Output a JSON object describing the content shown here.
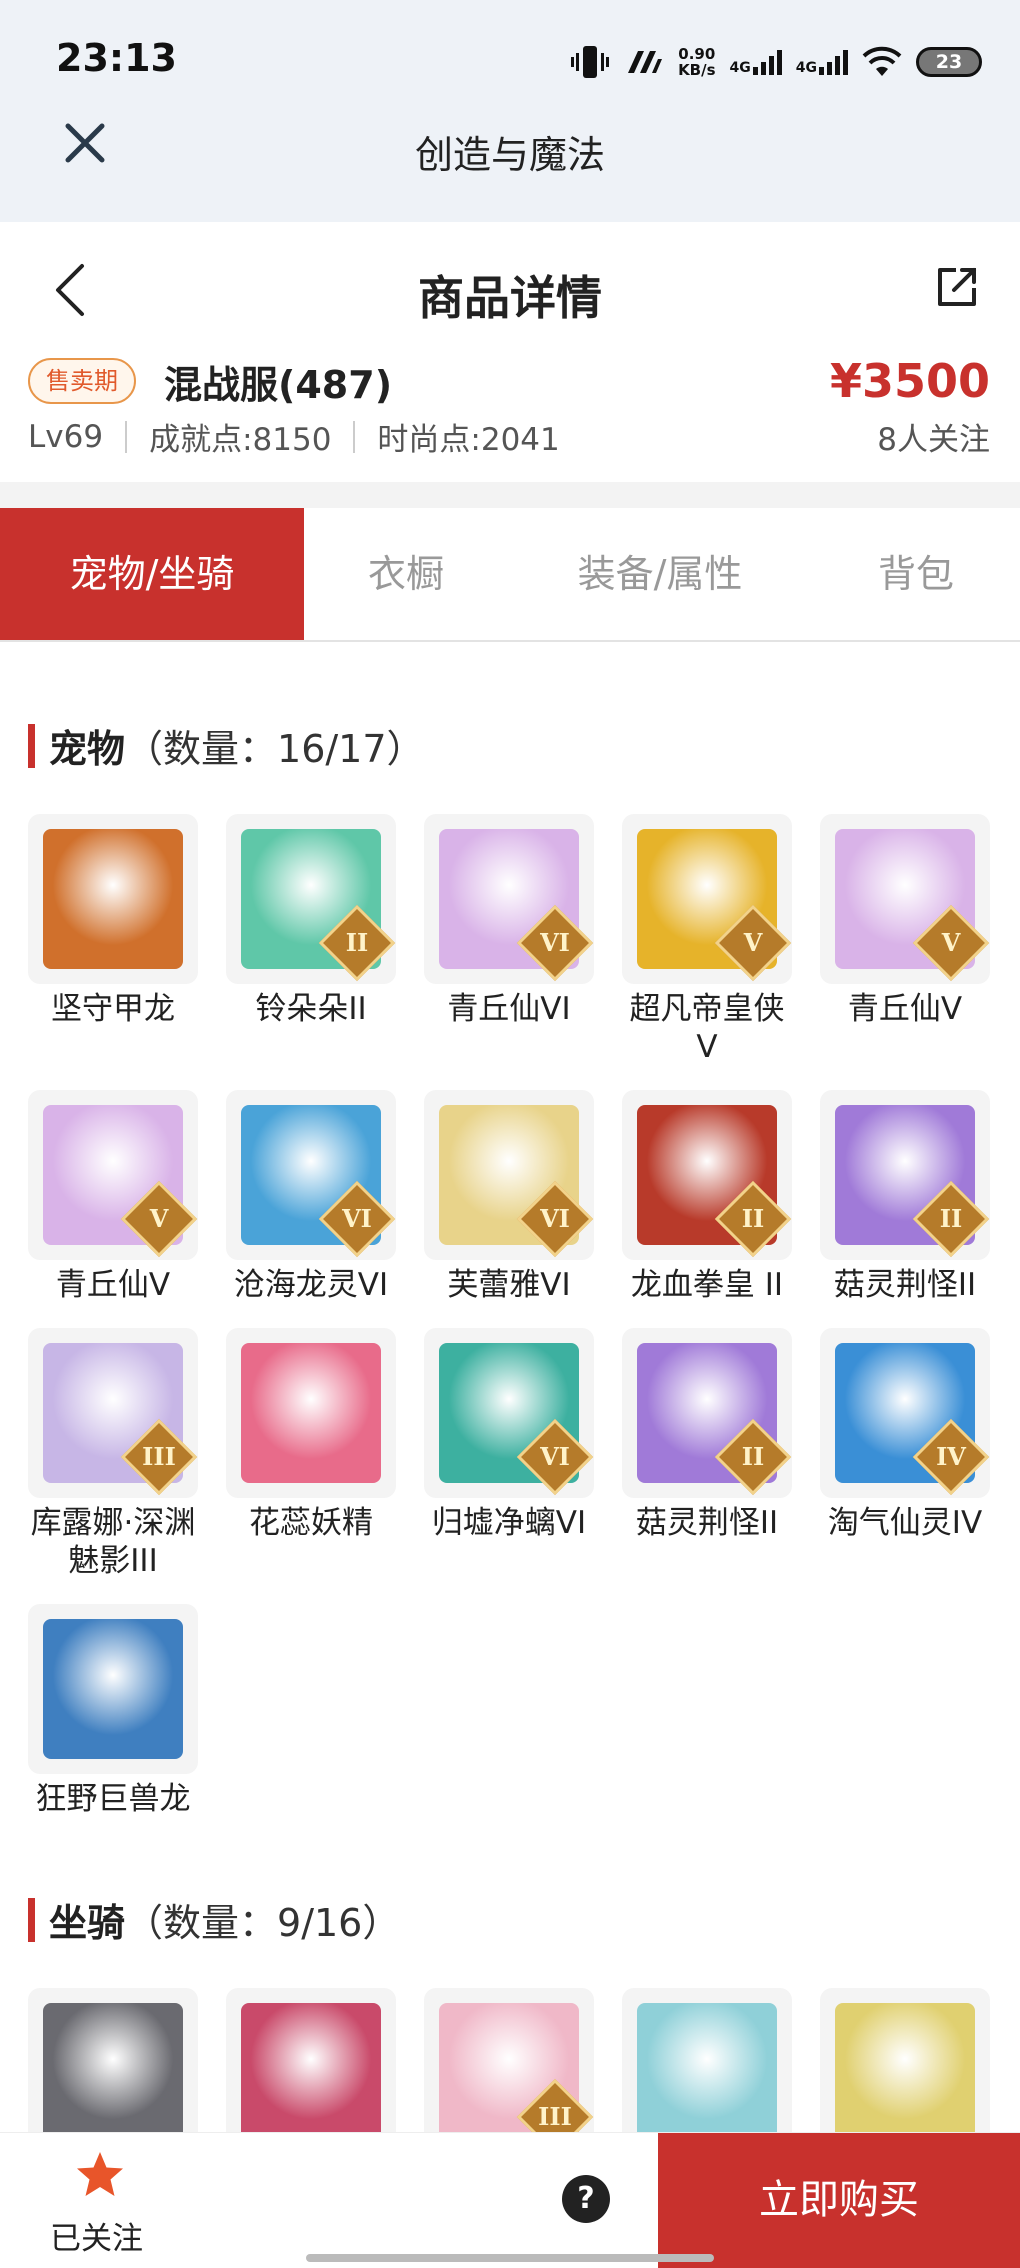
{
  "status_bar": {
    "time": "23:13",
    "net_speed": "0.90",
    "net_unit": "KB/s",
    "sim1": "4G",
    "sim2": "4G",
    "battery": "23"
  },
  "app_bar": {
    "title": "创造与魔法"
  },
  "nav": {
    "title": "商品详情"
  },
  "product": {
    "badge": "售卖期",
    "server": "混战服(487)",
    "price": "¥3500",
    "level": "Lv69",
    "achievement": "成就点:8150",
    "fashion": "时尚点:2041",
    "followers": "8人关注"
  },
  "tabs": [
    "宠物/坐骑",
    "衣橱",
    "装备/属性",
    "背包"
  ],
  "pets": {
    "title": "宠物",
    "count": "（数量：16/17）",
    "items": [
      {
        "name": "坚守甲龙",
        "tier": "",
        "color": "#d0702c"
      },
      {
        "name": "铃朵朵II",
        "tier": "II",
        "color": "#5fc7a8"
      },
      {
        "name": "青丘仙VI",
        "tier": "VI",
        "color": "#d9b3e8"
      },
      {
        "name": "超凡帝皇侠V",
        "tier": "V",
        "color": "#e6b32a"
      },
      {
        "name": "青丘仙V",
        "tier": "V",
        "color": "#d9b3e8"
      },
      {
        "name": "青丘仙V",
        "tier": "V",
        "color": "#d9b3e8"
      },
      {
        "name": "沧海龙灵VI",
        "tier": "VI",
        "color": "#4aa3d8"
      },
      {
        "name": "芙蕾雅VI",
        "tier": "VI",
        "color": "#e8d38a"
      },
      {
        "name": "龙血拳皇 II",
        "tier": "II",
        "color": "#b83a2a"
      },
      {
        "name": "菇灵荆怪II",
        "tier": "II",
        "color": "#a07ad8"
      },
      {
        "name": "库露娜·深渊魅影III",
        "tier": "III",
        "color": "#c7b6e6"
      },
      {
        "name": "花蕊妖精",
        "tier": "",
        "color": "#e86b8a"
      },
      {
        "name": "归墟净螭VI",
        "tier": "VI",
        "color": "#3db0a0"
      },
      {
        "name": "菇灵荆怪II",
        "tier": "II",
        "color": "#a07ad8"
      },
      {
        "name": "淘气仙灵IV",
        "tier": "IV",
        "color": "#3a8fd6"
      },
      {
        "name": "狂野巨兽龙",
        "tier": "",
        "color": "#3f7fc0"
      }
    ]
  },
  "mounts": {
    "title": "坐骑",
    "count": "（数量：9/16）",
    "items": [
      {
        "name": "",
        "tier": "",
        "color": "#6a6a70"
      },
      {
        "name": "",
        "tier": "",
        "color": "#c94a6a"
      },
      {
        "name": "",
        "tier": "III",
        "color": "#f0b8c8"
      },
      {
        "name": "",
        "tier": "",
        "color": "#8fd0d8"
      },
      {
        "name": "",
        "tier": "",
        "color": "#e0d070"
      }
    ]
  },
  "bottom_bar": {
    "follow_label": "已关注",
    "help_glyph": "?",
    "buy_label": "立即购买"
  }
}
